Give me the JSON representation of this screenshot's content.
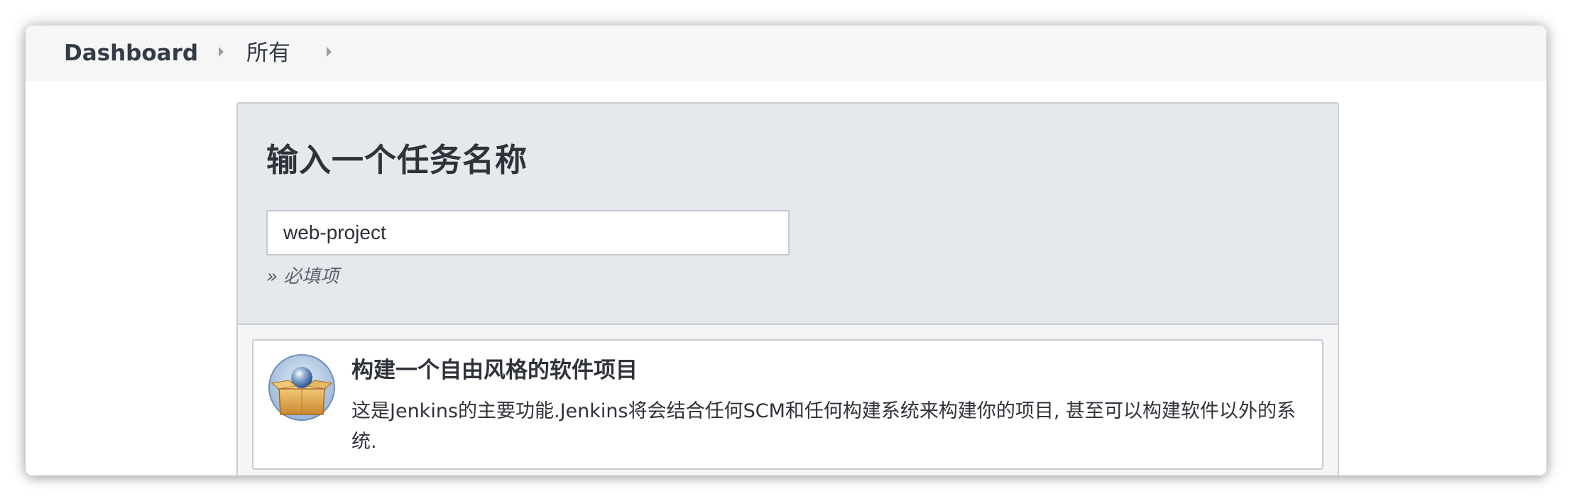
{
  "breadcrumb": {
    "home": "Dashboard",
    "all": "所有"
  },
  "form": {
    "title": "输入一个任务名称",
    "name_value": "web-project",
    "required_hint": "» 必填项"
  },
  "items": [
    {
      "icon": "freestyle-project-icon",
      "title": "构建一个自由风格的软件项目",
      "description": "这是Jenkins的主要功能.Jenkins将会结合任何SCM和任何构建系统来构建你的项目, 甚至可以构建软件以外的系统."
    }
  ],
  "colors": {
    "breadcrumb_bg": "#f6f6f7",
    "name_section_bg": "#e5e9ed",
    "text": "#2f3339"
  }
}
